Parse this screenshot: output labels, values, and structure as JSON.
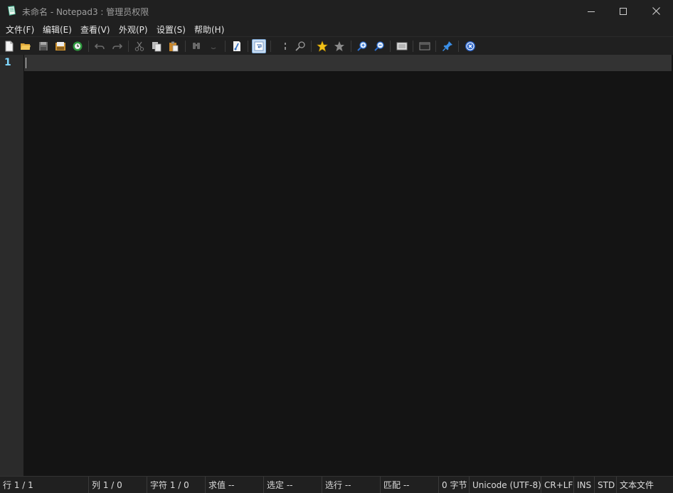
{
  "window": {
    "title": "未命名 - Notepad3 : 管理员权限",
    "icons": {
      "app": "notepad-icon",
      "minimize": "minimize-icon",
      "maximize": "maximize-icon",
      "close": "close-icon"
    }
  },
  "menu": {
    "file": "文件(F)",
    "edit": "编辑(E)",
    "view": "查看(V)",
    "appearance": "外观(P)",
    "settings": "设置(S)",
    "help": "帮助(H)"
  },
  "toolbar": {
    "buttons": [
      "new-file-icon",
      "open-file-icon",
      "save-icon",
      "save-as-icon",
      "browse-icon",
      "undo-icon",
      "redo-icon",
      "cut-icon",
      "copy-icon",
      "paste-icon",
      "find-icon",
      "replace-icon",
      "goto-icon",
      "word-wrap-icon",
      "toggle-fold-icon",
      "find-in-files-icon",
      "add-bookmark-icon",
      "bookmark-icon",
      "zoom-in-icon",
      "zoom-out-icon",
      "scheme-icon",
      "customize-icon",
      "pin-icon",
      "exit-icon"
    ],
    "active": "word-wrap-icon"
  },
  "editor": {
    "line_number": "1",
    "content": "",
    "colors": {
      "background": "#141414",
      "gutter": "#2b2b2b",
      "current_line": "#333333",
      "line_number": "#7fd7ff"
    }
  },
  "status": {
    "line": "行  1 / 1",
    "column": "列   1 / 0",
    "chars": "字符   1 / 0",
    "eval": "求值  --",
    "selection": "选定  --",
    "sel_lines": "选行  --",
    "match": "匹配  --",
    "bytes": "0 字节",
    "encoding": "Unicode (UTF-8)",
    "eol": "CR+LF",
    "ovr": "INS",
    "mode": "STD",
    "filetype": "文本文件"
  }
}
